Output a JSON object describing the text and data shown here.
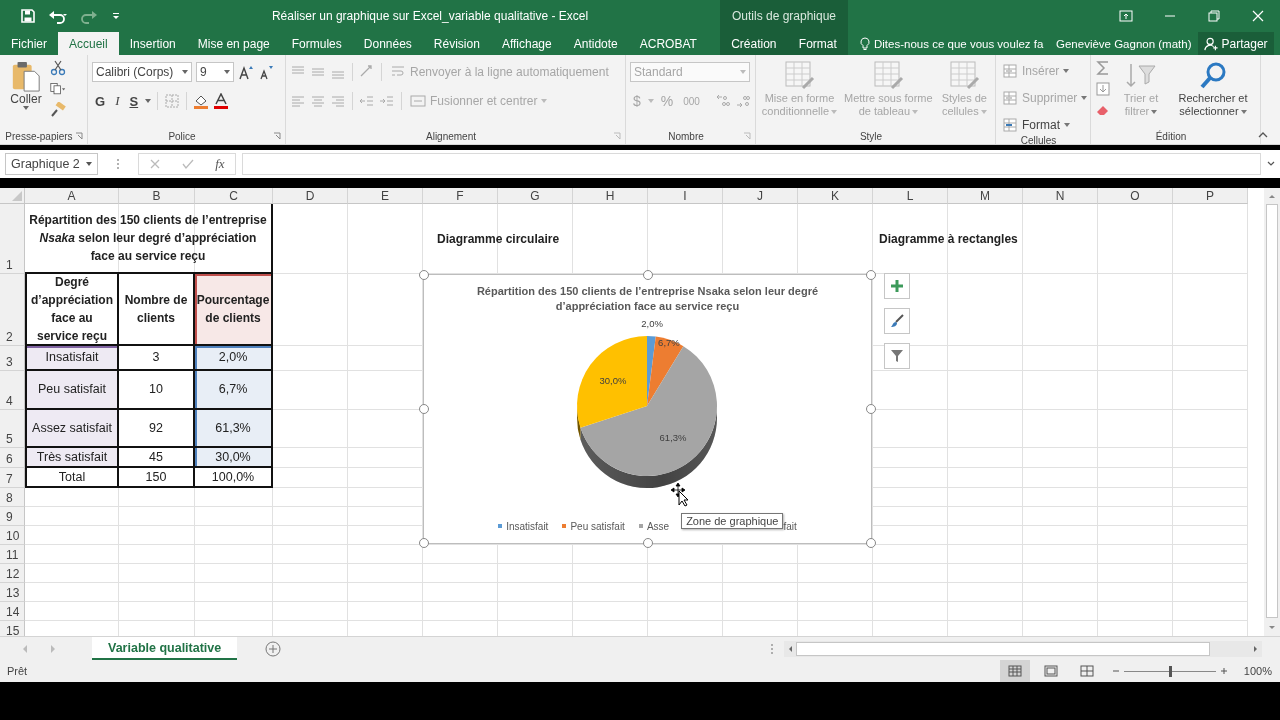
{
  "title_bar": {
    "title": "Réaliser un graphique sur Excel_variable qualitative - Excel",
    "context_label": "Outils de graphique"
  },
  "tabs": [
    {
      "label": "Fichier",
      "selected": false
    },
    {
      "label": "Accueil",
      "selected": true
    },
    {
      "label": "Insertion",
      "selected": false
    },
    {
      "label": "Mise en page",
      "selected": false
    },
    {
      "label": "Formules",
      "selected": false
    },
    {
      "label": "Données",
      "selected": false
    },
    {
      "label": "Révision",
      "selected": false
    },
    {
      "label": "Affichage",
      "selected": false
    },
    {
      "label": "Antidote",
      "selected": false
    },
    {
      "label": "ACROBAT",
      "selected": false
    }
  ],
  "context_tabs": [
    {
      "label": "Création",
      "selected": false
    },
    {
      "label": "Format",
      "selected": false
    }
  ],
  "tell_me": {
    "placeholder": "Dites-nous ce que vous voulez fa"
  },
  "user": "Geneviève Gagnon (math)",
  "share": "Partager",
  "ribbon": {
    "clipboard": {
      "label": "Presse-papiers",
      "paste": "Coller"
    },
    "font": {
      "label": "Police",
      "name": "Calibri (Corps)",
      "size": "9",
      "bold": "G",
      "italic": "I",
      "underline": "S"
    },
    "alignment": {
      "label": "Alignement",
      "wrap": "Renvoyer à la ligne automatiquement",
      "merge": "Fusionner et centrer",
      "disabled": true
    },
    "number": {
      "label": "Nombre",
      "format": "Standard",
      "currency": "$",
      "percent": "%",
      "thousands": "000",
      "disabled": true
    },
    "style": {
      "label": "Style",
      "buttons": [
        {
          "label": "Mise en forme conditionnelle",
          "disabled": true
        },
        {
          "label": "Mettre sous forme de tableau",
          "disabled": true
        },
        {
          "label": "Styles de cellules",
          "disabled": true
        }
      ]
    },
    "cells": {
      "label": "Cellules",
      "buttons": [
        {
          "label": "Insérer",
          "disabled": true
        },
        {
          "label": "Supprimer",
          "disabled": true
        },
        {
          "label": "Format",
          "disabled": false
        }
      ]
    },
    "editing": {
      "label": "Édition",
      "buttons": [
        {
          "label": "Trier et filtrer",
          "disabled": true
        },
        {
          "label": "Rechercher et sélectionner",
          "disabled": false
        }
      ]
    }
  },
  "formula_bar": {
    "name_box": "Graphique 2",
    "function_label": "fx"
  },
  "sheet": {
    "columns": [
      "A",
      "B",
      "C",
      "D",
      "E",
      "F",
      "G",
      "H",
      "I",
      "J",
      "K",
      "L",
      "M",
      "N",
      "O",
      "P"
    ],
    "rows": [
      "1",
      "2",
      "3",
      "4",
      "5",
      "6",
      "7",
      "8",
      "9",
      "10",
      "11",
      "12",
      "13",
      "14",
      "15"
    ],
    "table": {
      "title": "Répartition des 150 clients de l’entreprise *Nsaka* selon leur degré d’appréciation face au service reçu",
      "headers": [
        "Degré d’appréciation face au service reçu",
        "Nombre de clients",
        "Pourcentage de clients"
      ],
      "rows": [
        [
          "Insatisfait",
          "3",
          "2,0%"
        ],
        [
          "Peu satisfait",
          "10",
          "6,7%"
        ],
        [
          "Assez satisfait",
          "92",
          "61,3%"
        ],
        [
          "Très satisfait",
          "45",
          "30,0%"
        ]
      ],
      "total": [
        "Total",
        "150",
        "100,0%"
      ],
      "highlights": [
        {
          "kind": "categories",
          "color": "#8064a2"
        },
        {
          "kind": "series_name",
          "color": "#c0504d"
        },
        {
          "kind": "values",
          "color": "#4f81bd"
        }
      ]
    },
    "labels": [
      "Diagramme circulaire",
      "Diagramme à rectangles"
    ]
  },
  "chart": {
    "chart_data": {
      "type": "pie",
      "title": "Répartition des 150 clients de l’entreprise Nsaka selon leur degré d’appréciation face au service reçu",
      "series": [
        {
          "values": [
            2.0,
            6.7,
            61.3,
            30.0
          ]
        }
      ],
      "value_labels": [
        "2,0%",
        "6,7%",
        "61,3%",
        "30,0%"
      ]
    },
    "slices": [
      {
        "color": "#5b9bd5"
      },
      {
        "color": "#ed7d31"
      },
      {
        "color": "#a5a5a5"
      },
      {
        "color": "#ffc000"
      }
    ],
    "legend": [
      {
        "label": "Insatisfait",
        "color": "#5b9bd5",
        "marker": true
      },
      {
        "label": "Peu satisfait",
        "color": "#ed7d31",
        "marker": true
      },
      {
        "label": "Asse",
        "color": "#a5a5a5",
        "marker": true
      },
      {
        "label": "fait",
        "marker": false
      }
    ],
    "tooltip": "Zone de graphique"
  },
  "sheet_tabs": [
    {
      "label": "Variable qualitative",
      "selected": true
    }
  ],
  "status_bar": {
    "status": "Prêt",
    "views": [
      {
        "kind": "normal",
        "selected": true
      },
      {
        "kind": "page_layout",
        "selected": false
      },
      {
        "kind": "page_break",
        "selected": false
      }
    ],
    "zoom": {
      "level": 0.5,
      "label": "100%"
    }
  }
}
